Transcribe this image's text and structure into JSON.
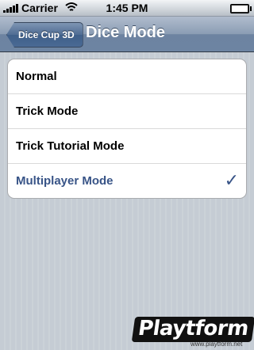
{
  "status_bar": {
    "carrier": "Carrier",
    "time": "1:45 PM",
    "battery_level": 1.0
  },
  "nav_bar": {
    "back_label": "Dice Cup 3D",
    "title": "Dice Mode"
  },
  "list": {
    "items": [
      {
        "label": "Normal",
        "selected": false
      },
      {
        "label": "Trick Mode",
        "selected": false
      },
      {
        "label": "Trick Tutorial Mode",
        "selected": false
      },
      {
        "label": "Multiplayer Mode",
        "selected": true
      }
    ],
    "check_glyph": "✓"
  },
  "watermark": {
    "logo": "Playtform",
    "url": "www.playtform.net"
  },
  "colors": {
    "selected_text": "#385487",
    "background": "#c5ccd4"
  }
}
